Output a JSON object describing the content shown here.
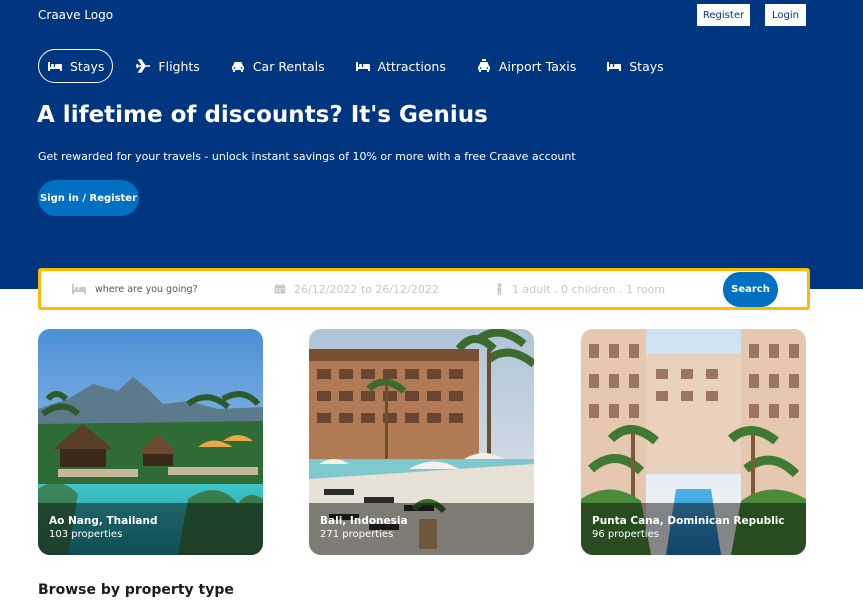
{
  "header": {
    "logo": "Craave Logo",
    "register_label": "Register",
    "login_label": "Login"
  },
  "nav": {
    "items": [
      {
        "label": "Stays",
        "icon": "bed-icon",
        "active": true
      },
      {
        "label": "Flights",
        "icon": "plane-icon",
        "active": false
      },
      {
        "label": "Car Rentals",
        "icon": "car-icon",
        "active": false
      },
      {
        "label": "Attractions",
        "icon": "bed-icon",
        "active": false
      },
      {
        "label": "Airport Taxis",
        "icon": "taxi-icon",
        "active": false
      },
      {
        "label": "Stays",
        "icon": "bed-icon",
        "active": false
      }
    ]
  },
  "hero": {
    "title": "A lifetime of discounts? It's Genius",
    "subtitle": "Get rewarded for your travels - unlock instant savings of 10% or more with a free Craave account",
    "signin_label": "Sign in / Register"
  },
  "search": {
    "destination_placeholder": "where are you going?",
    "dates": "26/12/2022 to 26/12/2022",
    "guests": "1 adult . 0 children . 1 room",
    "button_label": "Search"
  },
  "destinations": [
    {
      "name": "Ao Nang, Thailand",
      "count": "103 properties"
    },
    {
      "name": "Bali, Indonesia",
      "count": "271 properties"
    },
    {
      "name": "Punta Cana, Dominican Republic",
      "count": "96 properties"
    }
  ],
  "sections": {
    "browse_title": "Browse by property type"
  },
  "colors": {
    "brand_blue": "#003580",
    "button_blue": "#0071c2",
    "search_border": "#febb02"
  }
}
